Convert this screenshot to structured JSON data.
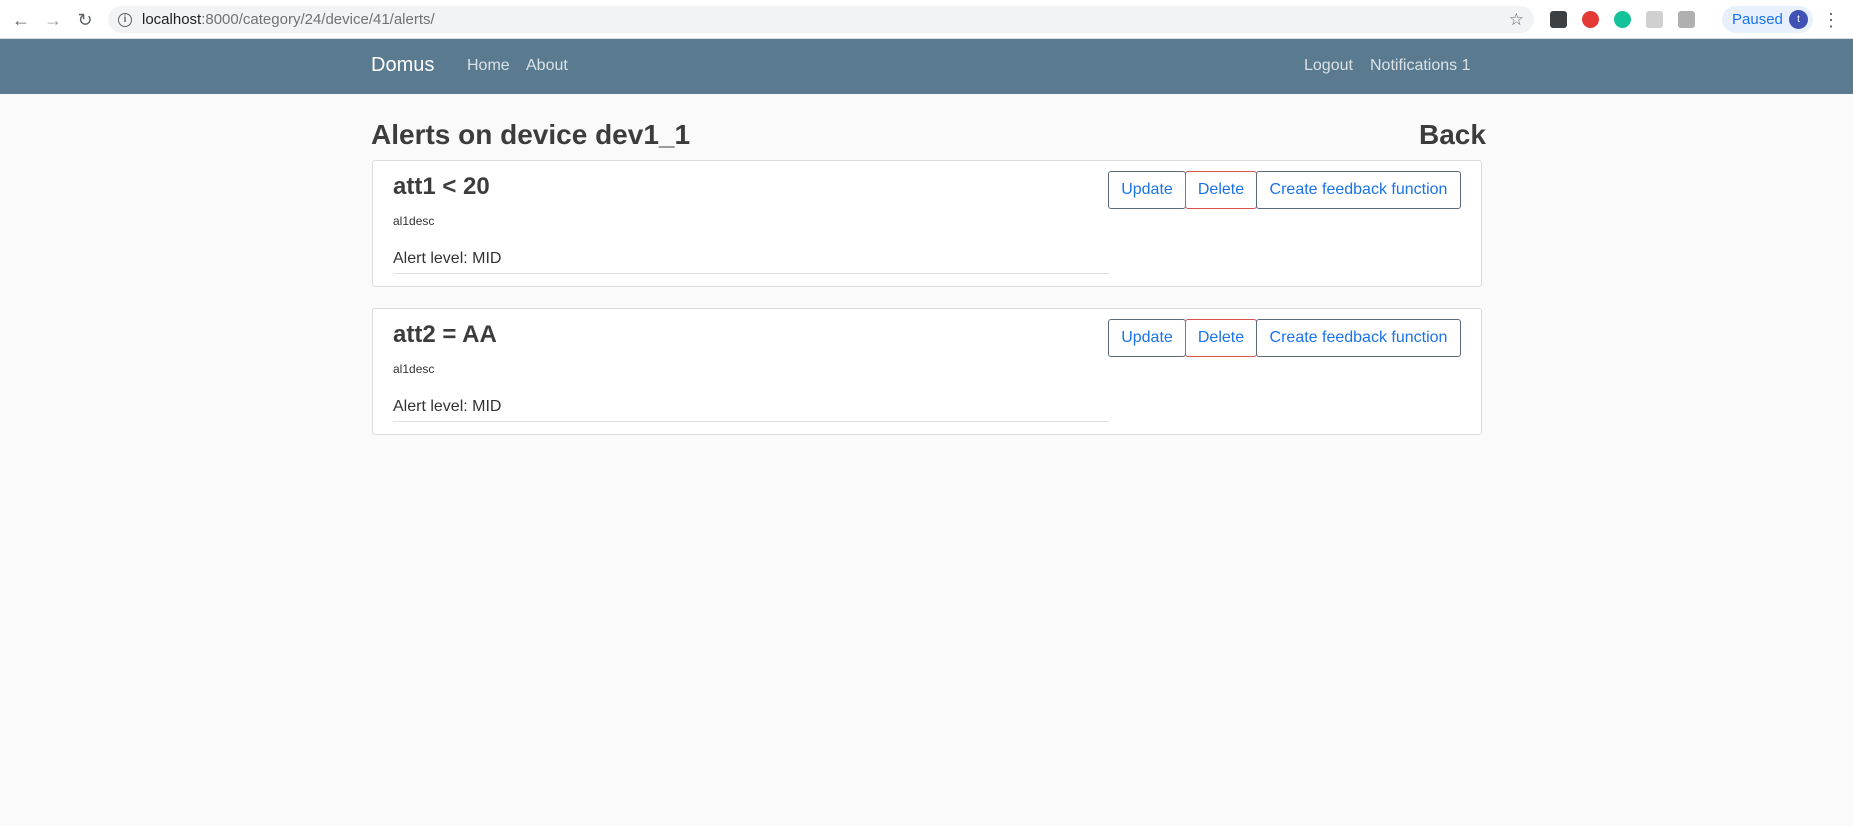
{
  "browser": {
    "url_host": "localhost",
    "url_path": ":8000/category/24/device/41/alerts/",
    "profile_status": "Paused",
    "profile_initial": "t",
    "icons": [
      "back-arrow-icon",
      "forward-arrow-icon",
      "reload-icon",
      "info-icon",
      "bookmark-star-icon",
      "menu-kebab-icon"
    ]
  },
  "navbar": {
    "brand": "Domus",
    "links": [
      "Home",
      "About"
    ],
    "right_links": [
      "Logout",
      "Notifications 1"
    ],
    "background": "#5a7a8f"
  },
  "page": {
    "title": "Alerts on device dev1_1",
    "back_label": "Back"
  },
  "alerts": [
    {
      "title": "att1 < 20",
      "description": "al1desc",
      "level": "Alert level: MID",
      "update_label": "Update",
      "delete_label": "Delete",
      "feedback_label": "Create feedback function"
    },
    {
      "title": "att2 = AA",
      "description": "al1desc",
      "level": "Alert level: MID",
      "update_label": "Update",
      "delete_label": "Delete",
      "feedback_label": "Create feedback function"
    }
  ],
  "colors": {
    "link_blue": "#1a73e8",
    "delete_border": "#d9534f"
  }
}
